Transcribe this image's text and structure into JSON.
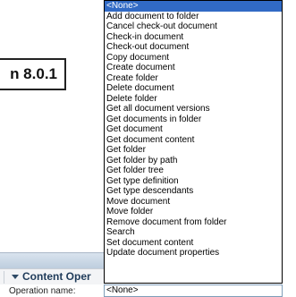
{
  "version": {
    "text": "n 8.0.1"
  },
  "panel": {
    "title": "Content Oper"
  },
  "operation": {
    "label": "Operation name:",
    "selected": "<None>",
    "options": [
      "<None>",
      "Add document to folder",
      "Cancel check-out document",
      "Check-in document",
      "Check-out document",
      "Copy document",
      "Create document",
      "Create folder",
      "Delete document",
      "Delete folder",
      "Get all document versions",
      "Get documents in folder",
      "Get document",
      "Get document content",
      "Get folder",
      "Get folder by path",
      "Get folder tree",
      "Get type definition",
      "Get type descendants",
      "Move document",
      "Move folder",
      "Remove document from folder",
      "Search",
      "Set document content",
      "Update document properties"
    ]
  },
  "colors": {
    "highlight": "#316ac5",
    "panel_title": "#1f3b5a"
  },
  "icons": {
    "collapse": "triangle-down-icon"
  }
}
